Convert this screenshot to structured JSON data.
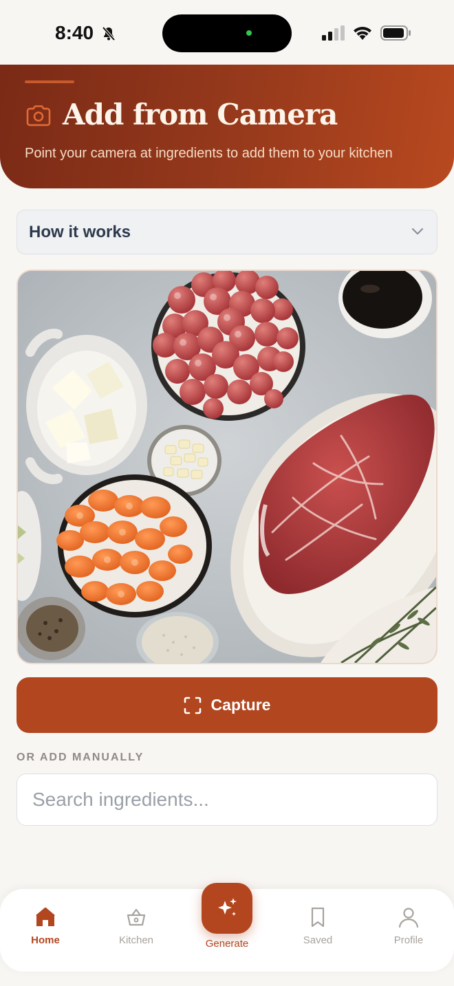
{
  "status_bar": {
    "time": "8:40",
    "icons": [
      "bell-slash-icon",
      "signal-icon",
      "wifi-icon",
      "battery-icon"
    ]
  },
  "header": {
    "title": "Add from Camera",
    "subtitle": "Point your camera at ingredients to add them to your kitchen",
    "icon": "camera-icon"
  },
  "how_it_works": {
    "label": "How it works",
    "expanded": false
  },
  "camera": {
    "preview_icon": "camera-viewfinder"
  },
  "capture": {
    "label": "Capture",
    "icon": "scan-frame-icon"
  },
  "manual": {
    "label": "OR ADD MANUALLY",
    "search_placeholder": "Search ingredients...",
    "search_value": ""
  },
  "nav": {
    "items": [
      {
        "label": "Home",
        "icon": "home-icon",
        "active": true
      },
      {
        "label": "Kitchen",
        "icon": "basket-icon",
        "active": false
      },
      {
        "label": "Generate",
        "icon": "sparkles-icon",
        "active": false
      },
      {
        "label": "Saved",
        "icon": "bookmark-icon",
        "active": false
      },
      {
        "label": "Profile",
        "icon": "user-icon",
        "active": false
      }
    ]
  },
  "colors": {
    "accent": "#b1461f",
    "header_dark": "#7a2a16",
    "background": "#f8f6f3"
  }
}
